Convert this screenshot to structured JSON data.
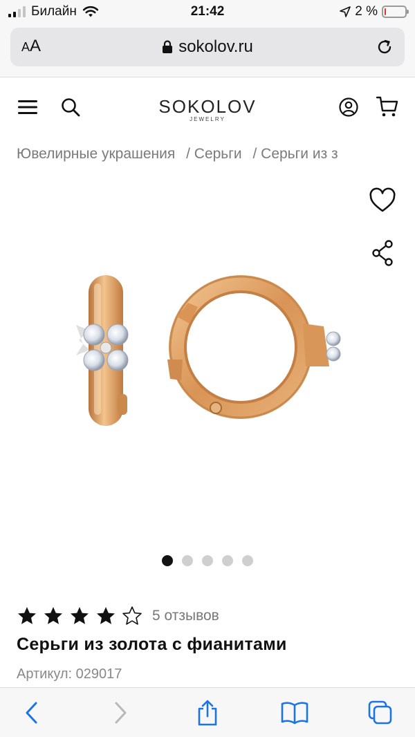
{
  "status_bar": {
    "carrier": "Билайн",
    "time": "21:42",
    "battery_percent": "2 %",
    "battery_level": 0.02
  },
  "browser": {
    "text_size_label_small": "A",
    "text_size_label_large": "A",
    "url": "sokolov.ru"
  },
  "header": {
    "logo_main": "SOKOLOV",
    "logo_sub": "JEWELRY"
  },
  "breadcrumb": {
    "items": [
      "Ювелирные украшения",
      "/ Серьги",
      "/ Серьги из з"
    ]
  },
  "gallery": {
    "total_images": 5,
    "active_index": 0
  },
  "product": {
    "rating": 4,
    "rating_max": 5,
    "reviews_label": "5 отзывов",
    "title": "Серьги из золота с фианитами",
    "article": "Артикул: 029017"
  },
  "colors": {
    "gold": "#e3a468",
    "gold_dark": "#b8733d",
    "text": "#111111",
    "muted": "#7a7a7a",
    "accent_blue": "#1a73e8"
  }
}
